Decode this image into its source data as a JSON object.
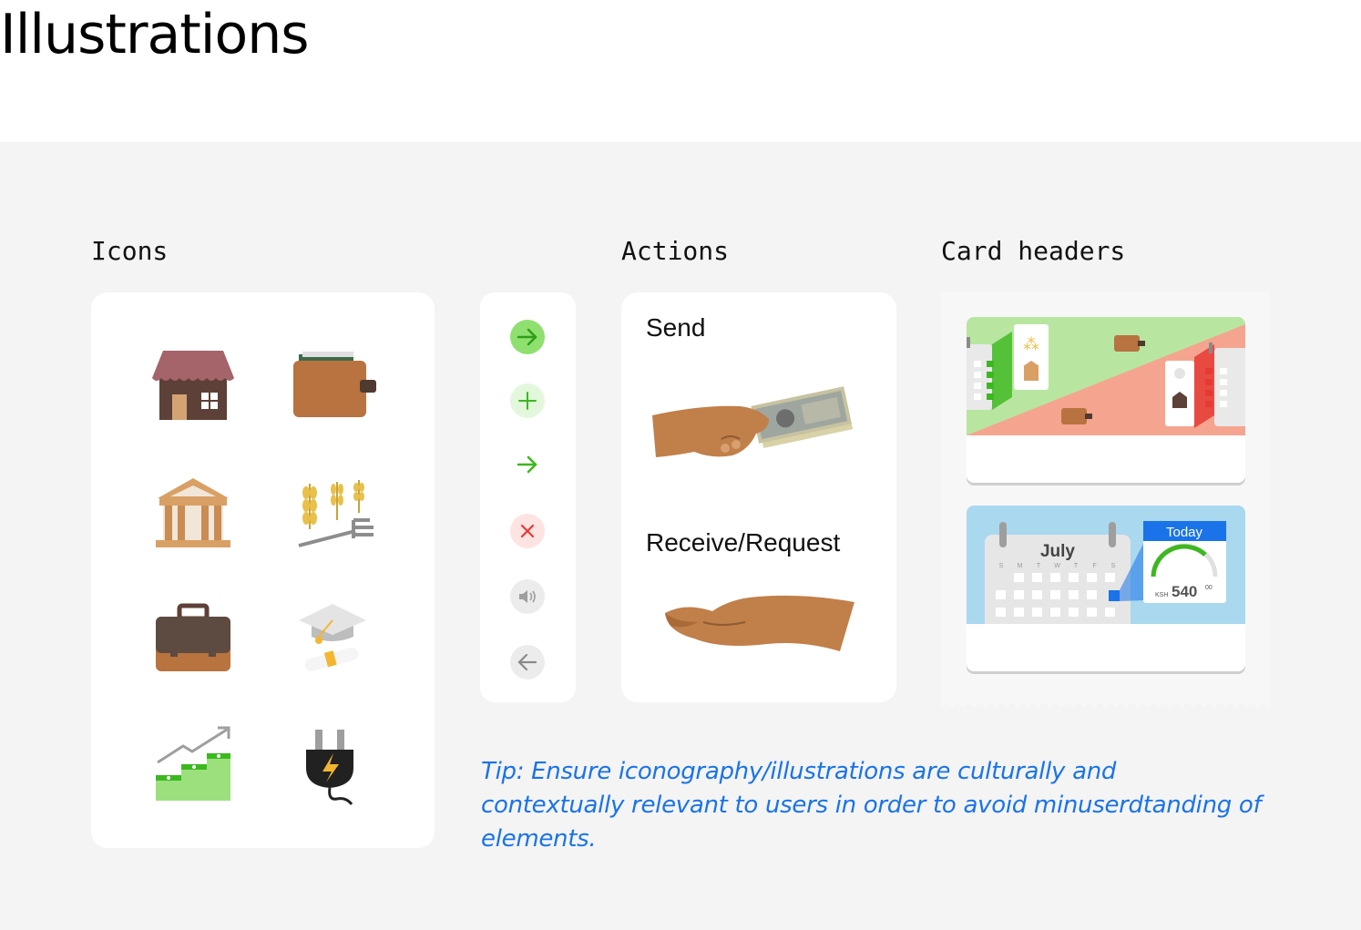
{
  "page": {
    "title": "Illustrations"
  },
  "sections": {
    "icons_label": "Icons",
    "actions_label": "Actions",
    "cards_label": "Card headers"
  },
  "icons": [
    {
      "name": "house-icon"
    },
    {
      "name": "wallet-icon"
    },
    {
      "name": "bank-icon"
    },
    {
      "name": "wheat-pitchfork-icon"
    },
    {
      "name": "briefcase-icon"
    },
    {
      "name": "graduation-icon"
    },
    {
      "name": "money-growth-icon"
    },
    {
      "name": "power-plug-icon"
    }
  ],
  "action_buttons": [
    {
      "name": "arrow-right-filled-icon",
      "color": "#3cb81f"
    },
    {
      "name": "plus-icon",
      "color": "#3cb81f"
    },
    {
      "name": "arrow-right-icon",
      "color": "#3cb81f"
    },
    {
      "name": "close-icon",
      "color": "#e53935"
    },
    {
      "name": "speaker-icon",
      "color": "#9e9e9e"
    },
    {
      "name": "arrow-left-icon",
      "color": "#9e9e9e"
    }
  ],
  "actions": {
    "send_label": "Send",
    "receive_label": "Receive/Request"
  },
  "card_headers": {
    "calendar_month": "July",
    "weekdays": [
      "S",
      "M",
      "T",
      "W",
      "T",
      "F",
      "S"
    ],
    "today_label": "Today",
    "currency": "KSH",
    "amount": "540",
    "amount_cents": "00"
  },
  "tip": "Tip: Ensure iconography/illustrations are culturally and contextually relevant to users in order to avoid minuserdtanding of elements.",
  "colors": {
    "background": "#f4f4f4",
    "tip_text": "#1a73e8",
    "accent_green": "#3cb81f",
    "header_green": "#b8e6a0",
    "header_red": "#f5a58f",
    "header_blue": "#a9d8ef",
    "today_blue": "#1a73e8"
  }
}
